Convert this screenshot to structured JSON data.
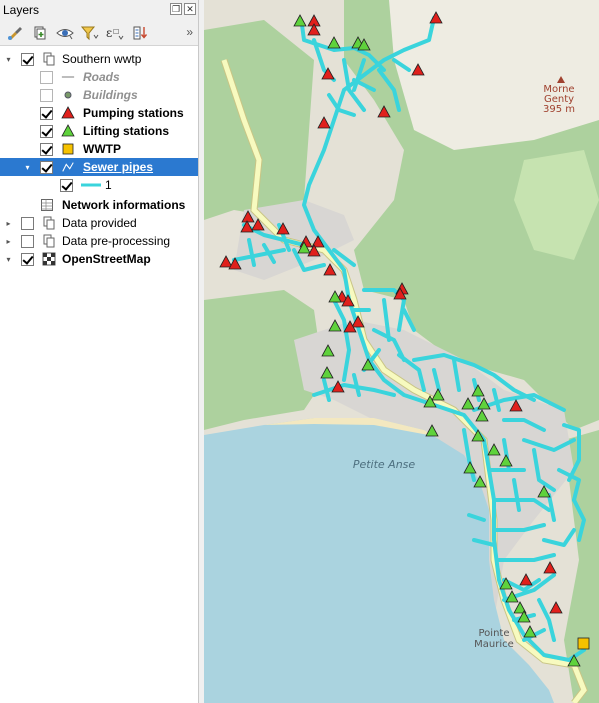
{
  "dock": {
    "title": "Layers",
    "float_glyph": "❐",
    "close_glyph": "✕",
    "more_glyph": "»"
  },
  "toolbar": {
    "icons": [
      "paintbrush-icon",
      "add-group-icon",
      "eye-icon",
      "filter-icon",
      "expression-filter-icon",
      "expand-all-icon"
    ]
  },
  "layers": {
    "group_name": "Southern wwtp",
    "roads": "Roads",
    "buildings": "Buildings",
    "pumping": "Pumping stations",
    "lifting": "Lifting stations",
    "wwtp": "WWTP",
    "sewer": "Sewer pipes",
    "sewer_class": "1",
    "network_info": "Network informations",
    "data_provided": "Data provided",
    "data_preprocessing": "Data pre-processing",
    "osm": "OpenStreetMap"
  },
  "map": {
    "labels": {
      "peak_name": "Morne",
      "peak_name_2": "Genty",
      "peak_elev": "395 m",
      "bay": "Petite Anse",
      "point": "Pointe",
      "point_2": "Maurice"
    },
    "colors": {
      "water": "#aad3df",
      "forest": "#add19e",
      "land": "#e4e1d6",
      "residential": "#d8d6d3",
      "road": "#f7fabf",
      "road_casing": "#c9c585",
      "pipe": "#3ad4dc",
      "pumping": "#e0201c",
      "lifting": "#5fd23c",
      "wwtp": "#f6c200",
      "peak": "#a0422f"
    }
  }
}
